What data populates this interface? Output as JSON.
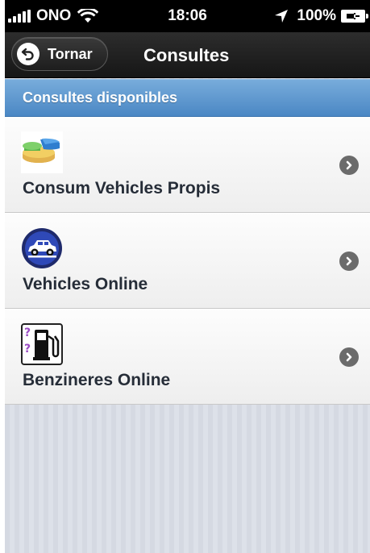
{
  "status_bar": {
    "carrier": "ONO",
    "time": "18:06",
    "battery": "100%"
  },
  "nav": {
    "back_label": "Tornar",
    "title": "Consultes"
  },
  "list": {
    "header": "Consultes disponibles",
    "items": [
      {
        "label": "Consum Vehicles Propis",
        "icon": "pie-chart-icon"
      },
      {
        "label": "Vehicles Online",
        "icon": "car-icon"
      },
      {
        "label": "Benzineres Online",
        "icon": "fuel-pump-icon"
      }
    ]
  },
  "colors": {
    "header_blue": "#4a87c4",
    "nav_dark": "#1d1d1d",
    "label_text": "#262d38"
  }
}
